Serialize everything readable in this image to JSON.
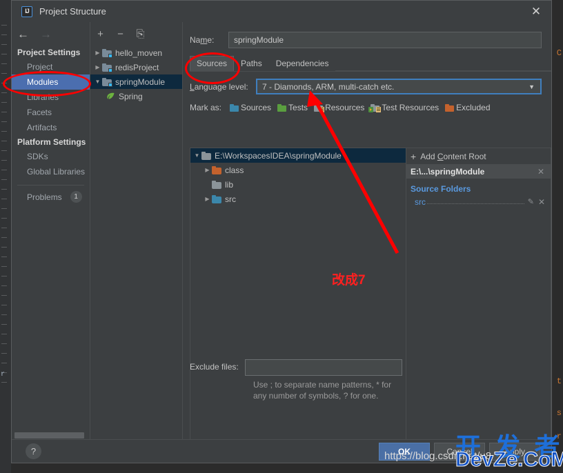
{
  "window": {
    "title": "Project Structure",
    "app_icon": "intellij-idea-icon",
    "close_label": "✕"
  },
  "sidebar": {
    "back_icon": "←",
    "forward_icon": "→",
    "groups": [
      {
        "header": "Project Settings",
        "items": [
          "Project",
          "Modules",
          "Libraries",
          "Facets",
          "Artifacts"
        ]
      },
      {
        "header": "Platform Settings",
        "items": [
          "SDKs",
          "Global Libraries"
        ]
      }
    ],
    "selected_item": "Modules",
    "problems": {
      "label": "Problems",
      "count": "1"
    }
  },
  "module_tree": {
    "toolbar": {
      "add": "+",
      "remove": "−",
      "copy": "⎘"
    },
    "nodes": [
      {
        "label": "hello_moven",
        "twisty": "▶",
        "selected": false,
        "icon": "module-folder-icon"
      },
      {
        "label": "redisProject",
        "twisty": "▶",
        "selected": false,
        "icon": "module-folder-icon"
      },
      {
        "label": "springModule",
        "twisty": "▼",
        "selected": true,
        "icon": "module-folder-icon"
      },
      {
        "label": "Spring",
        "twisty": "",
        "selected": false,
        "icon": "spring-leaf-icon"
      }
    ]
  },
  "editor": {
    "name_label": "Name:",
    "name_value": "springModule",
    "tabs": [
      {
        "label": "Sources",
        "active": true
      },
      {
        "label": "Paths",
        "active": false
      },
      {
        "label": "Dependencies",
        "active": false
      }
    ],
    "language_level": {
      "label": "Language level:",
      "value": "7 - Diamonds, ARM, multi-catch etc.",
      "arrow": "▼",
      "focus_color": "#3f7fbf"
    },
    "mark_as": {
      "label": "Mark as:",
      "buttons": [
        {
          "label": "Sources",
          "icon": "sources-folder-icon",
          "color": "#3b87ab"
        },
        {
          "label": "Tests",
          "icon": "tests-folder-icon",
          "color": "#5a9e3f"
        },
        {
          "label": "Resources",
          "icon": "resources-folder-icon",
          "color": "#8b9499"
        },
        {
          "label": "Test Resources",
          "icon": "test-resources-folder-icon",
          "color": "#8b9499"
        },
        {
          "label": "Excluded",
          "icon": "excluded-folder-icon",
          "color": "#c4622d"
        }
      ]
    },
    "content_tree": [
      {
        "label": "E:\\WorkspacesIDEA\\springModule",
        "twisty": "▼",
        "indent": 0,
        "selected": true,
        "icon": "folder-grey-icon"
      },
      {
        "label": "class",
        "twisty": "▶",
        "indent": 1,
        "selected": false,
        "icon": "folder-orange-icon"
      },
      {
        "label": "lib",
        "twisty": "",
        "indent": 1,
        "selected": false,
        "icon": "folder-grey-icon"
      },
      {
        "label": "src",
        "twisty": "▶",
        "indent": 1,
        "selected": false,
        "icon": "folder-blue-icon"
      }
    ],
    "roots_pane": {
      "add_content_root": "Add Content Root",
      "add_icon": "plus-icon",
      "root_path": "E:\\...\\springModule",
      "remove_icon": "✕",
      "source_folders_title": "Source Folders",
      "source_folders": [
        {
          "name": "src",
          "edit_icon": "pencil-icon",
          "remove_icon": "✕"
        }
      ]
    },
    "exclude": {
      "label": "Exclude files:",
      "value": "",
      "hint_line1": "Use ; to separate name patterns, * for",
      "hint_line2": "any number of symbols, ? for one."
    }
  },
  "footer": {
    "help_icon": "?",
    "buttons": [
      {
        "label": "OK",
        "primary": true
      },
      {
        "label": "Cancel",
        "primary": false
      },
      {
        "label": "Apply",
        "primary": false
      }
    ]
  },
  "annotations": {
    "note_text": "改成7",
    "color": "#ff0000",
    "ellipse_modules": "highlight around Modules sidebar item",
    "ellipse_sources": "highlight around Sources tab",
    "arrow": "red arrow pointing to Language level combo"
  },
  "watermark": {
    "cn": "开 发 者",
    "en": "DevZe.CoM",
    "url": "https://blog.csdn.net/u8"
  }
}
